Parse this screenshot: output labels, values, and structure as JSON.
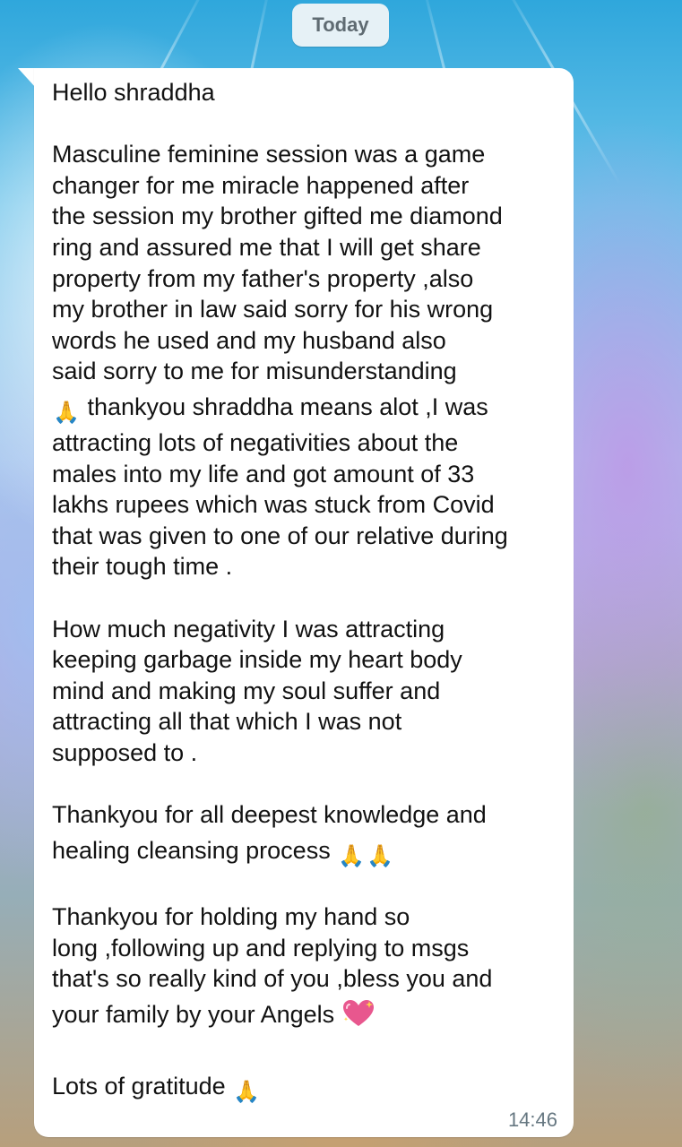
{
  "date_chip": "Today",
  "message": {
    "time": "14:46",
    "greeting": "Hello shraddha",
    "paragraph1": [
      "Masculine feminine session was a game",
      "changer for me miracle happened after",
      "the session my brother gifted me diamond",
      "ring and assured me that I will get share",
      "property from my father's property ,also",
      "my brother in law said sorry for his wrong",
      "words he used and my husband also",
      "said sorry to me for misunderstanding"
    ],
    "paragraph1_emoji_line": " thankyou shraddha means alot ,I was",
    "paragraph1_rest": [
      "attracting lots of negativities about the",
      "males into my life and got amount of 33",
      "lakhs rupees which was stuck from Covid",
      "that was given to one of our relative during",
      "their tough time ."
    ],
    "paragraph2": [
      "How much negativity I was attracting",
      "keeping garbage inside my heart body",
      "mind and making my soul suffer and",
      "attracting all that which I was not",
      "supposed to ."
    ],
    "paragraph3_line1": "Thankyou for all deepest knowledge and",
    "paragraph3_line2": "healing cleansing process ",
    "paragraph4": [
      "Thankyou for holding my hand so",
      "long ,following up and replying to msgs",
      "that's so really kind of you ,bless you and"
    ],
    "paragraph4_last": "your family by your Angels ",
    "closing": "Lots of gratitude ",
    "emojis": {
      "pray": "🙏",
      "sparkling_heart": "sparkling-heart-icon"
    }
  },
  "colors": {
    "bubble": "#ffffff",
    "timestamp": "#667781",
    "date_chip_bg": "#e6f1f6",
    "heart": "#e8578e"
  }
}
